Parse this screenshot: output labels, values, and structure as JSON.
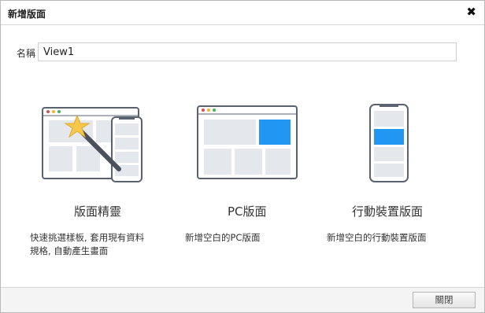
{
  "dialog": {
    "title": "新增版面",
    "close_icon": "close-icon"
  },
  "form": {
    "name_label": "名稱",
    "name_value": "View1"
  },
  "options": [
    {
      "title": "版面精靈",
      "desc_line1": "快速挑選樣板, 套用現有資料",
      "desc_line2": "規格, 自動產生畫面",
      "icon": "wizard-layout-icon"
    },
    {
      "title": "PC版面",
      "desc_line1": "新增空白的PC版面",
      "icon": "desktop-layout-icon"
    },
    {
      "title": "行動裝置版面",
      "desc_line1": "新增空白的行動裝置版面",
      "icon": "mobile-layout-icon"
    }
  ],
  "colors": {
    "frame": "#5a6270",
    "panel": "#e4e8ec",
    "accent": "#2196f3",
    "star": "#f6c84a"
  },
  "footer": {
    "close_label": "關閉"
  }
}
